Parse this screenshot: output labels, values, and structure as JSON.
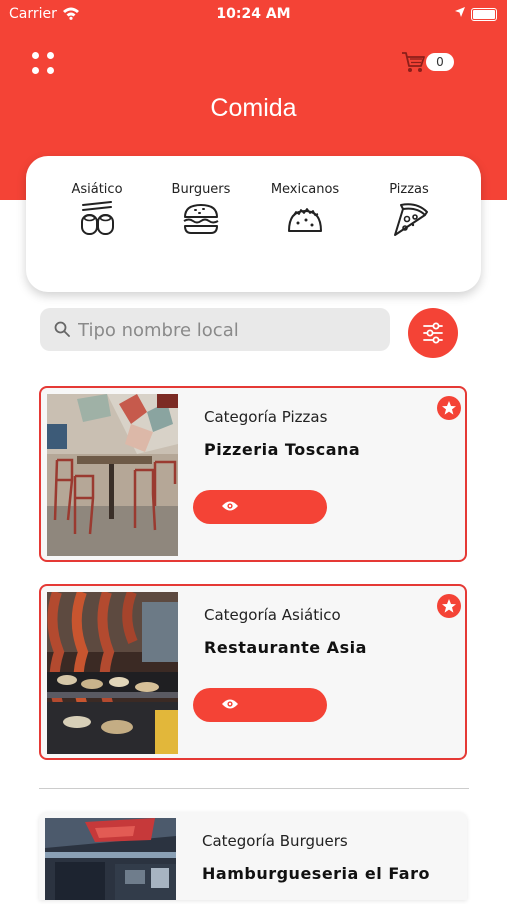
{
  "status_bar": {
    "carrier": "Carrier",
    "time": "10:24 AM"
  },
  "header": {
    "title": "Comida",
    "cart_count": "0"
  },
  "categories": [
    {
      "label": "Asiático",
      "icon": "sushi-icon"
    },
    {
      "label": "Burguers",
      "icon": "burger-icon"
    },
    {
      "label": "Mexicanos",
      "icon": "taco-icon"
    },
    {
      "label": "Pizzas",
      "icon": "pizza-icon"
    }
  ],
  "search": {
    "placeholder": "Tipo nombre local"
  },
  "restaurants": [
    {
      "category": "Categoría Pizzas",
      "name": "Pizzeria Toscana"
    },
    {
      "category": "Categoría Asiático",
      "name": "Restaurante Asia"
    },
    {
      "category": "Categoría Burguers",
      "name": "Hamburgueseria el Faro"
    }
  ],
  "colors": {
    "accent": "#f44336",
    "border": "#e53935",
    "card_bg": "#f7f7f7"
  }
}
